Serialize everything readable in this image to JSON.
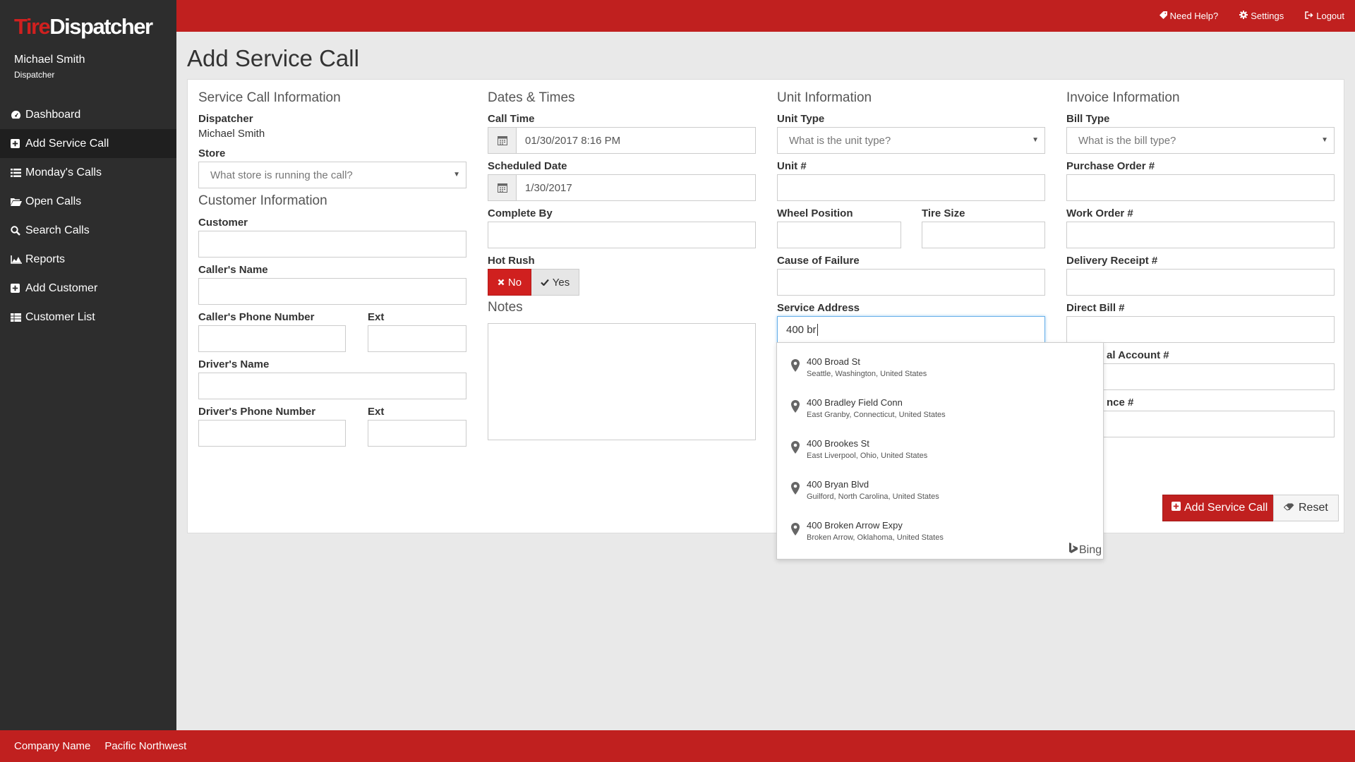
{
  "app": {
    "logo_part1": "Tire",
    "logo_part2": "Dispatcher",
    "user_name": "Michael Smith",
    "user_role": "Dispatcher"
  },
  "nav": {
    "items": [
      {
        "label": "Dashboard",
        "icon": "dashboard-icon"
      },
      {
        "label": "Add Service Call",
        "icon": "plus-square-icon"
      },
      {
        "label": "Monday's Calls",
        "icon": "list-icon"
      },
      {
        "label": "Open Calls",
        "icon": "folder-open-icon"
      },
      {
        "label": "Search Calls",
        "icon": "search-icon"
      },
      {
        "label": "Reports",
        "icon": "area-chart-icon"
      },
      {
        "label": "Add Customer",
        "icon": "plus-square-icon"
      },
      {
        "label": "Customer List",
        "icon": "table-icon"
      }
    ],
    "active_index": 1
  },
  "topbar": {
    "help": "Need Help?",
    "settings": "Settings",
    "logout": "Logout"
  },
  "footer": {
    "company": "Company Name",
    "region": "Pacific Northwest"
  },
  "page": {
    "title": "Add Service Call"
  },
  "service_call": {
    "title": "Service Call Information",
    "dispatcher_label": "Dispatcher",
    "dispatcher_value": "Michael Smith",
    "store_label": "Store",
    "store_placeholder": "What store is running the call?"
  },
  "customer": {
    "title": "Customer Information",
    "customer_label": "Customer",
    "callers_name_label": "Caller's Name",
    "callers_phone_label": "Caller's Phone Number",
    "ext_label": "Ext",
    "drivers_name_label": "Driver's Name",
    "drivers_phone_label": "Driver's Phone Number",
    "ext2_label": "Ext"
  },
  "dates": {
    "title": "Dates & Times",
    "call_time_label": "Call Time",
    "call_time_value": "01/30/2017 8:16 PM",
    "scheduled_label": "Scheduled Date",
    "scheduled_value": "1/30/2017",
    "complete_by_label": "Complete By",
    "hot_rush_label": "Hot Rush",
    "hot_rush_no": "No",
    "hot_rush_yes": "Yes",
    "hot_rush_selected": "No",
    "notes_title": "Notes"
  },
  "unit": {
    "title": "Unit Information",
    "unit_type_label": "Unit Type",
    "unit_type_placeholder": "What is the unit type?",
    "unit_num_label": "Unit #",
    "wheel_position_label": "Wheel Position",
    "tire_size_label": "Tire Size",
    "cause_label": "Cause of Failure",
    "service_address_label": "Service Address",
    "service_address_value": "400 br"
  },
  "invoice": {
    "title": "Invoice Information",
    "bill_type_label": "Bill Type",
    "bill_type_placeholder": "What is the bill type?",
    "po_label": "Purchase Order #",
    "wo_label": "Work Order #",
    "delivery_label": "Delivery Receipt #",
    "direct_bill_label": "Direct Bill #",
    "national_account_label": "al Account #",
    "reference_label": "nce #"
  },
  "actions": {
    "add": "Add Service Call",
    "reset": "Reset"
  },
  "suggestions": {
    "items": [
      {
        "line1": "400 Broad St",
        "line2": "Seattle, Washington, United States"
      },
      {
        "line1": "400 Bradley Field Conn",
        "line2": "East Granby, Connecticut, United States"
      },
      {
        "line1": "400 Brookes St",
        "line2": "East Liverpool, Ohio, United States"
      },
      {
        "line1": "400 Bryan Blvd",
        "line2": "Guilford, North Carolina, United States"
      },
      {
        "line1": "400 Broken Arrow Expy",
        "line2": "Broken Arrow, Oklahoma, United States"
      }
    ],
    "provider": "Bing"
  },
  "colors": {
    "brand_red": "#c0201f",
    "sidebar_bg": "#2d2d2d",
    "active_nav_bg": "#1f1f1f"
  }
}
